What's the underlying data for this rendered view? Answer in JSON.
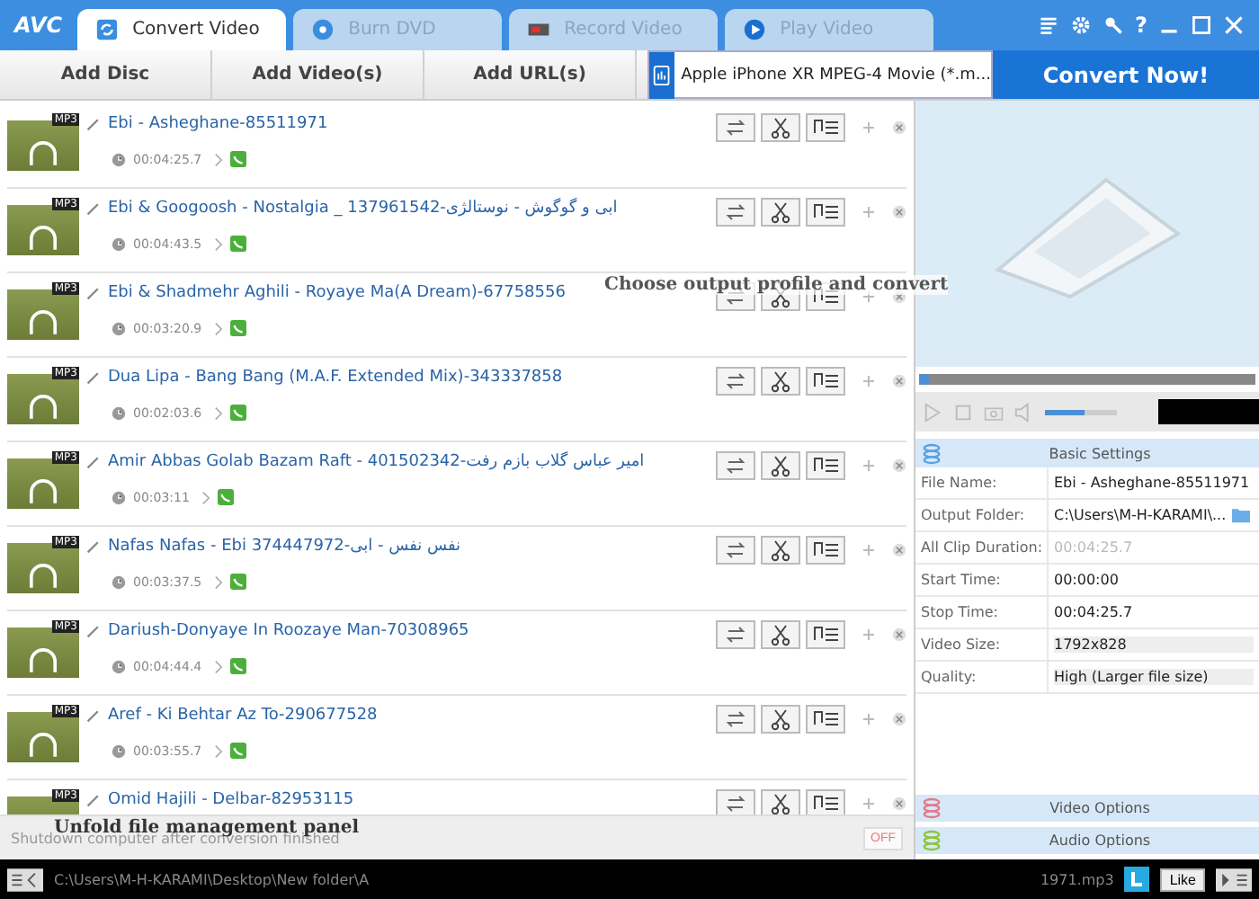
{
  "logo": "AVC",
  "help_glyph": "?",
  "tabs": [
    {
      "label": "Convert Video",
      "kind": "convert",
      "selected": true
    },
    {
      "label": "Burn DVD",
      "kind": "disc",
      "selected": false
    },
    {
      "label": "Record Video",
      "kind": "record",
      "selected": false
    },
    {
      "label": "Play Video",
      "kind": "play",
      "selected": false
    }
  ],
  "toolbar": {
    "buttons": [
      "Add Disc",
      "Add Video(s)",
      "Add URL(s)"
    ],
    "profile": "Apple iPhone XR MPEG-4 Movie (*.m...",
    "convert": "Convert Now!"
  },
  "files": [
    {
      "format": "MP3",
      "title": "Ebi - Asheghane-85511971",
      "duration": "00:04:25.7"
    },
    {
      "format": "MP3",
      "title": "Ebi & Googoosh - Nostalgia _ 137961542-ابی و گوگوش - نوستالژی",
      "duration": "00:04:43.5"
    },
    {
      "format": "MP3",
      "title": "Ebi & Shadmehr Aghili - Royaye Ma(A Dream)-67758556",
      "duration": "00:03:20.9"
    },
    {
      "format": "MP3",
      "title": "Dua Lipa - Bang Bang (M.A.F. Extended Mix)-343337858",
      "duration": "00:02:03.6"
    },
    {
      "format": "MP3",
      "title": "Amir Abbas Golab Bazam Raft - 401502342-امیر عباس گلاب بازم رفت",
      "duration": "00:03:11"
    },
    {
      "format": "MP3",
      "title": "Nafas Nafas - Ebi  374447972-نفس نفس - ابی",
      "duration": "00:03:37.5"
    },
    {
      "format": "MP3",
      "title": "Dariush-Donyaye In Roozaye Man-70308965",
      "duration": "00:04:44.4"
    },
    {
      "format": "MP3",
      "title": "Aref - Ki Behtar Az To-290677528",
      "duration": "00:03:55.7"
    },
    {
      "format": "MP3",
      "title": "Omid Hajili - Delbar-82953115"
    }
  ],
  "hints": {
    "profile": "Choose output profile and convert",
    "panel": "Unfold file management panel"
  },
  "shutdown": {
    "label": "Shutdown computer after conversion finished",
    "toggle": "OFF"
  },
  "player": {
    "position": {
      "level": 0.02
    },
    "volume": {
      "level": 0.55
    }
  },
  "settings": {
    "title": "Basic Settings",
    "rows": [
      {
        "label": "File Name:",
        "value": "Ebi - Asheghane-85511971",
        "kind": "text"
      },
      {
        "label": "Output Folder:",
        "value": "C:\\Users\\M-H-KARAMI\\...",
        "kind": "folder"
      },
      {
        "label": "All Clip Duration:",
        "value": "00:04:25.7",
        "kind": "disabled"
      },
      {
        "label": "Start Time:",
        "value": "00:00:00",
        "kind": "text"
      },
      {
        "label": "Stop Time:",
        "value": "00:04:25.7",
        "kind": "text"
      },
      {
        "label": "Video Size:",
        "value": "1792x828",
        "kind": "select"
      },
      {
        "label": "Quality:",
        "value": "High (Larger file size)",
        "kind": "select"
      }
    ]
  },
  "sections": [
    {
      "label": "Video Options",
      "color": "#e07a8a"
    },
    {
      "label": "Audio Options",
      "color": "#8cc43c"
    }
  ],
  "status": {
    "path": "C:\\Users\\M-H-KARAMI\\Desktop\\New folder\\A",
    "tail": "1971.mp3",
    "like": "Like"
  }
}
